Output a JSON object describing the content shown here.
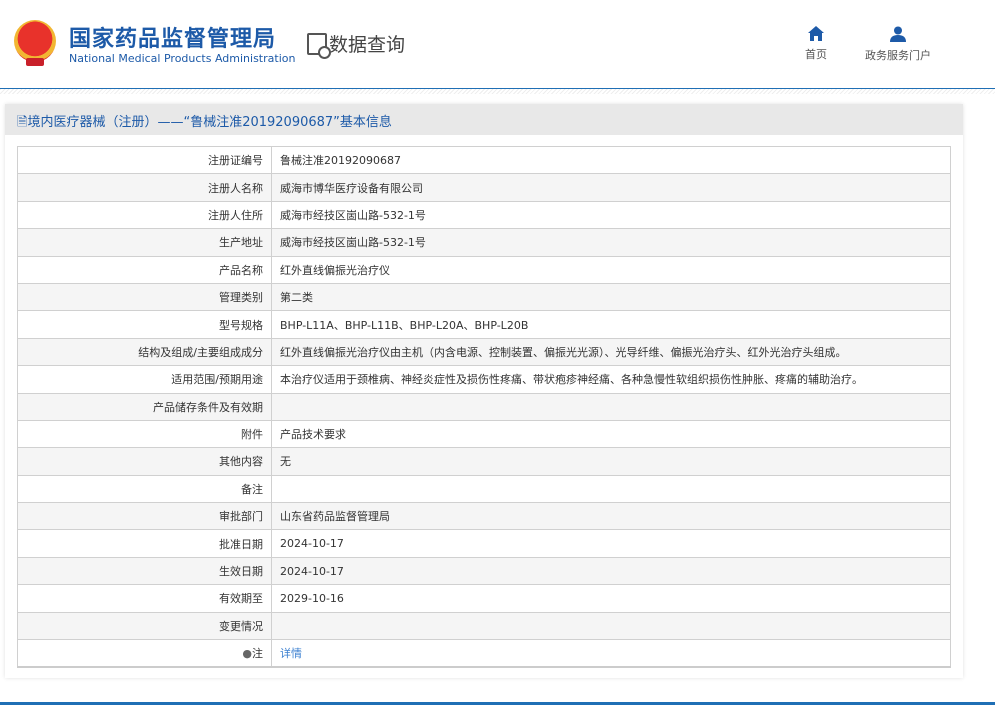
{
  "header": {
    "logo_cn": "国家药品监督管理局",
    "logo_en": "National Medical Products Administration",
    "query_label": "数据查询",
    "nav": [
      {
        "label": "首页",
        "icon": "home-icon"
      },
      {
        "label": "政务服务门户",
        "icon": "user-icon"
      }
    ]
  },
  "panel": {
    "title": "境内医疗器械（注册）——“鲁械注准20192090687”基本信息"
  },
  "rows": [
    {
      "label": "注册证编号",
      "value": "鲁械注准20192090687"
    },
    {
      "label": "注册人名称",
      "value": "威海市博华医疗设备有限公司"
    },
    {
      "label": "注册人住所",
      "value": "威海市经技区崮山路-532-1号"
    },
    {
      "label": "生产地址",
      "value": "威海市经技区崮山路-532-1号"
    },
    {
      "label": "产品名称",
      "value": "红外直线偏振光治疗仪"
    },
    {
      "label": "管理类别",
      "value": "第二类"
    },
    {
      "label": "型号规格",
      "value": "BHP-L11A、BHP-L11B、BHP-L20A、BHP-L20B"
    },
    {
      "label": "结构及组成/主要组成成分",
      "value": "红外直线偏振光治疗仪由主机（内含电源、控制装置、偏振光光源）、光导纤维、偏振光治疗头、红外光治疗头组成。"
    },
    {
      "label": "适用范围/预期用途",
      "value": "本治疗仪适用于颈椎病、神经炎症性及损伤性疼痛、带状疱疹神经痛、各种急慢性软组织损伤性肿胀、疼痛的辅助治疗。"
    },
    {
      "label": "产品储存条件及有效期",
      "value": ""
    },
    {
      "label": "附件",
      "value": "产品技术要求"
    },
    {
      "label": "其他内容",
      "value": "无"
    },
    {
      "label": "备注",
      "value": ""
    },
    {
      "label": "审批部门",
      "value": "山东省药品监督管理局"
    },
    {
      "label": "批准日期",
      "value": "2024-10-17"
    },
    {
      "label": "生效日期",
      "value": "2024-10-17"
    },
    {
      "label": "有效期至",
      "value": "2029-10-16"
    },
    {
      "label": "变更情况",
      "value": ""
    },
    {
      "label": "注",
      "value": "详情"
    }
  ]
}
